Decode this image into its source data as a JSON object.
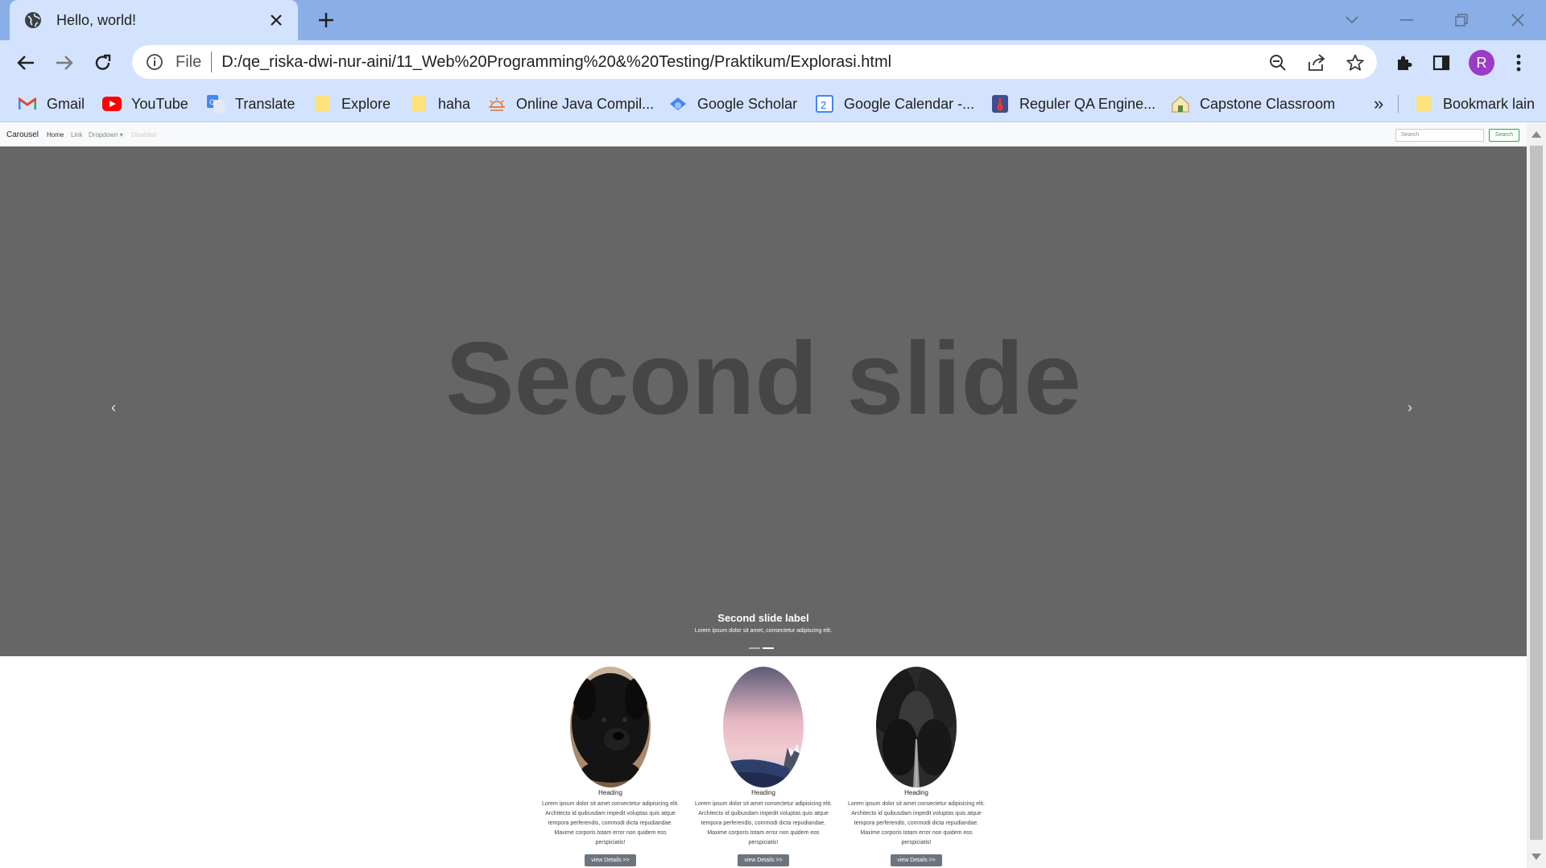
{
  "browser": {
    "tab_title": "Hello, world!",
    "omnibox_scheme": "File",
    "url": "D:/qe_riska-dwi-nur-aini/11_Web%20Programming%20&%20Testing/Praktikum/Explorasi.html",
    "profile_initial": "R",
    "bookmarks": [
      {
        "label": "Gmail",
        "icon": "gmail-icon"
      },
      {
        "label": "YouTube",
        "icon": "youtube-icon"
      },
      {
        "label": "Translate",
        "icon": "translate-icon"
      },
      {
        "label": "Explore",
        "icon": "folder-icon"
      },
      {
        "label": "haha",
        "icon": "folder-icon"
      },
      {
        "label": "Online Java Compil...",
        "icon": "sun-icon"
      },
      {
        "label": "Google Scholar",
        "icon": "scholar-icon"
      },
      {
        "label": "Google Calendar -...",
        "icon": "calendar-icon"
      },
      {
        "label": "Reguler QA Engine...",
        "icon": "tie-icon"
      },
      {
        "label": "Capstone Classroom",
        "icon": "classroom-icon"
      }
    ],
    "bookmarks_more": "»",
    "other_bookmarks": "Bookmark lain"
  },
  "page": {
    "navbar": {
      "brand": "Carousel",
      "links": [
        {
          "label": "Home",
          "state": "active"
        },
        {
          "label": "Link",
          "state": "normal"
        },
        {
          "label": "Dropdown ▾",
          "state": "normal"
        },
        {
          "label": "Disabled",
          "state": "disabled"
        }
      ],
      "search_placeholder": "Search",
      "search_button": "Search"
    },
    "carousel": {
      "slide_text": "Second slide",
      "caption_title": "Second slide label",
      "caption_text": "Lorem ipsum dolor sit amet, consectetur adipiscing elit.",
      "prev": "‹",
      "next": "›",
      "indicator_count": 2,
      "active_indicator": 1
    },
    "columns": [
      {
        "heading": "Heading",
        "text": "Lorem ipsum dolor sit amet consectetur adipisicing elit. Architecto id quibusdam impedit voluptas quis atque tempora perferendis, commodi dicta repudiandae. Maxime corporis totam error non quidem eos perspiciatis!",
        "button": "view Details >>",
        "image": "black-dog"
      },
      {
        "heading": "Heading",
        "text": "Lorem ipsum dolor sit amet consectetur adipisicing elit. Architecto id quibusdam impedit voluptas quis atque tempora perferendis, commodi dicta repudiandae. Maxime corporis totam error non quidem eos perspiciatis!",
        "button": "view Details >>",
        "image": "pink-sky-mountain"
      },
      {
        "heading": "Heading",
        "text": "Lorem ipsum dolor sit amet consectetur adipisicing elit. Architecto id quibusdam impedit voluptas quis atque tempora perferendis, commodi dicta repudiandae. Maxime corporis totam error non quidem eos perspiciatis!",
        "button": "view Details >>",
        "image": "dark-forest-road"
      }
    ]
  },
  "colors": {
    "tabbar": "#8aaee6",
    "toolbar": "#d3e3fd",
    "carousel_bg": "#666666",
    "slide_text": "#464646",
    "button": "#6c757d",
    "search_outline": "#28a745"
  }
}
